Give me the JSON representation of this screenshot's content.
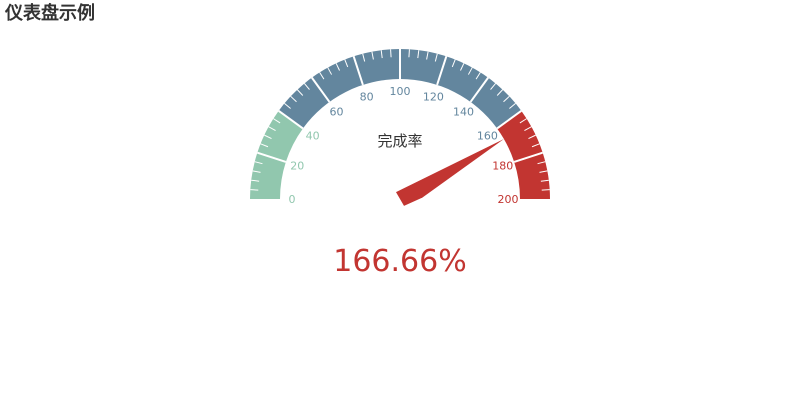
{
  "chart_data": {
    "type": "gauge",
    "title": "仪表盘示例",
    "gauge_label": "完成率",
    "value": 166.66,
    "value_text": "166.66%",
    "min": 0,
    "max": 200,
    "tick_labels": [
      "0",
      "20",
      "40",
      "60",
      "80",
      "100",
      "120",
      "140",
      "160",
      "180",
      "200"
    ],
    "color_bands": [
      {
        "upto": 0.2,
        "color": "#91c7ae"
      },
      {
        "upto": 0.8,
        "color": "#63869e"
      },
      {
        "upto": 1.0,
        "color": "#c23531"
      }
    ],
    "pointer_color": "#c23531",
    "value_color": "#c23531"
  }
}
